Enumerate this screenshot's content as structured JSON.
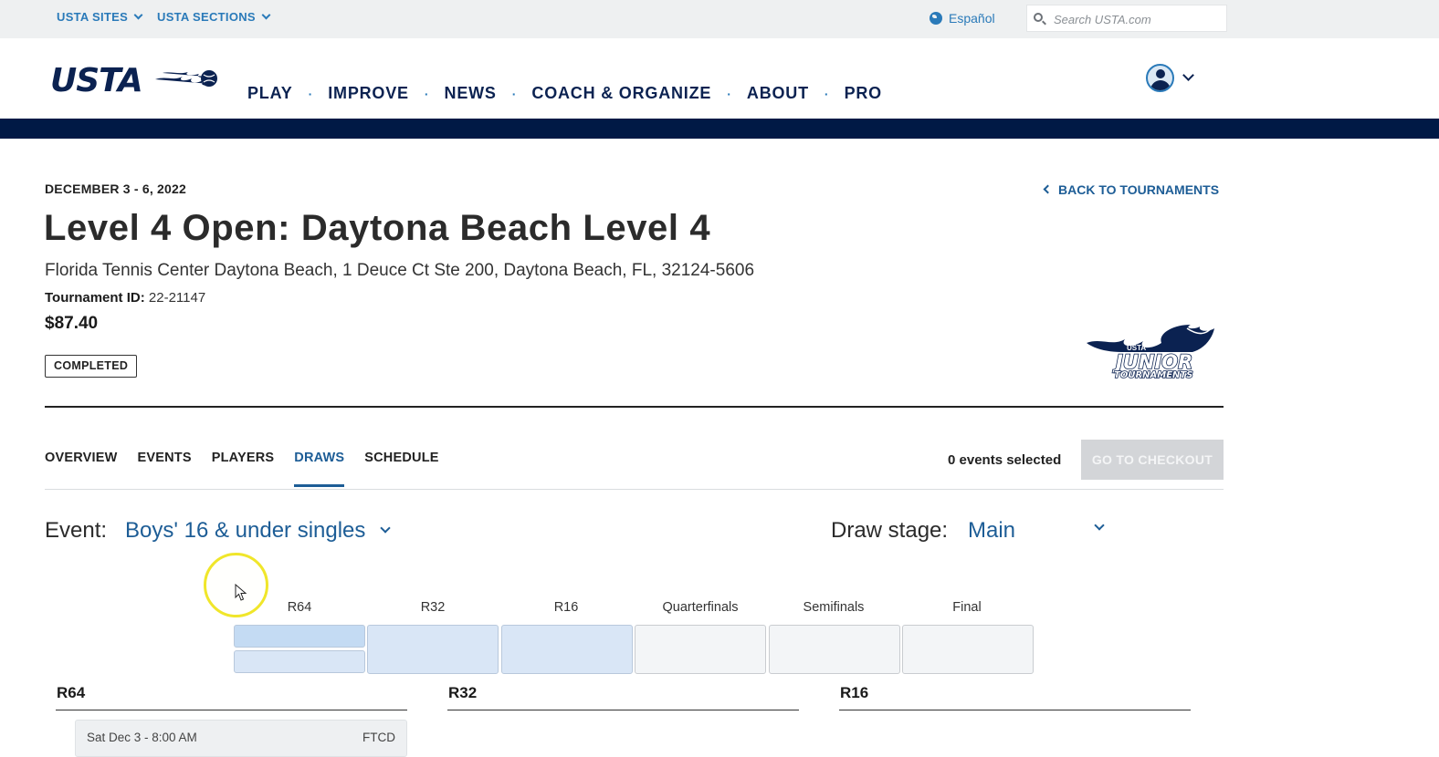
{
  "topbar": {
    "sites_label": "USTA SITES",
    "sections_label": "USTA SECTIONS",
    "language_label": "Español",
    "search_placeholder": "Search USTA.com"
  },
  "header": {
    "logo_text": "USTA",
    "nav": [
      "PLAY",
      "IMPROVE",
      "NEWS",
      "COACH & ORGANIZE",
      "ABOUT",
      "PRO"
    ]
  },
  "tournament": {
    "date": "DECEMBER 3 - 6, 2022",
    "back_label": "BACK TO TOURNAMENTS",
    "title": "Level 4 Open: Daytona Beach Level 4",
    "address": "Florida Tennis Center Daytona Beach, 1 Deuce Ct Ste 200, Daytona Beach, FL, 32124-5606",
    "id_label": "Tournament ID:",
    "id_value": "22-21147",
    "price": "$87.40",
    "status": "COMPLETED",
    "logo_small": "USTA",
    "logo_main": "JUNIOR",
    "logo_sub": "TOURNAMENTS"
  },
  "tabs": {
    "items": [
      "OVERVIEW",
      "EVENTS",
      "PLAYERS",
      "DRAWS",
      "SCHEDULE"
    ],
    "active": "DRAWS",
    "events_selected": "0 events selected",
    "checkout_label": "GO TO CHECKOUT"
  },
  "draw": {
    "event_label": "Event:",
    "event_value": "Boys' 16 & under singles",
    "stage_label": "Draw stage:",
    "stage_value": "Main",
    "rounds": [
      "R64",
      "R32",
      "R16",
      "Quarterfinals",
      "Semifinals",
      "Final"
    ],
    "columns": [
      "R64",
      "R32",
      "R16"
    ],
    "first_match": {
      "time": "Sat Dec 3 - 8:00 AM",
      "location": "FTCD"
    }
  },
  "colors": {
    "navy": "#0b2251",
    "accent_blue": "#1d5d96",
    "link_blue": "#2a7ab9",
    "band": "#001945",
    "round_selected": "#d9e6f6",
    "checkout_disabled": "#d3d5d8"
  },
  "icons": [
    "chevron-down-icon",
    "globe-icon",
    "search-icon",
    "user-avatar-icon",
    "chevron-left-icon",
    "cursor-icon"
  ]
}
